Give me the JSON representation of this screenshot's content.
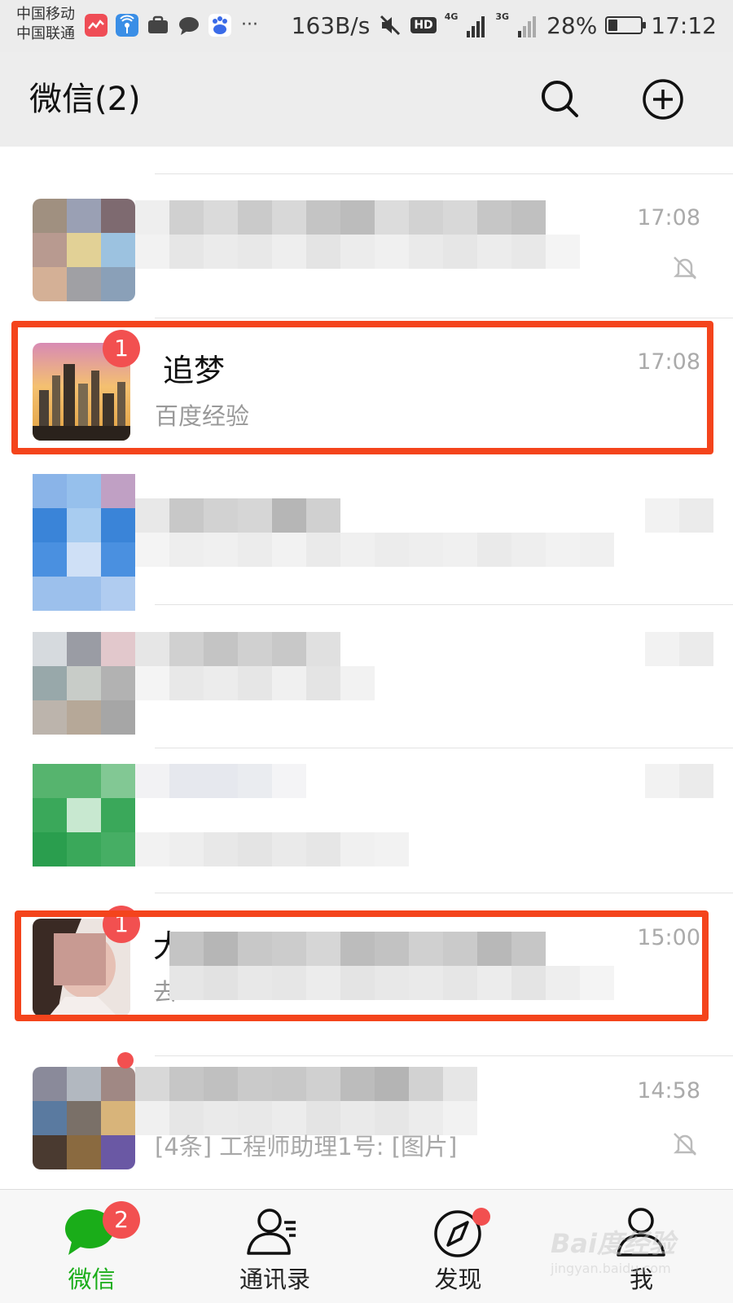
{
  "status_bar": {
    "carrier_1": "中国移动",
    "carrier_2": "中国联通",
    "more": "···",
    "net_speed": "163B/s",
    "hd": "HD",
    "net_4g": "4G",
    "net_3g": "3G",
    "battery": "28%",
    "battery_level": 0.28,
    "time": "17:12"
  },
  "header": {
    "title": "微信(2)",
    "search_icon": "search-icon",
    "add_icon": "plus-circle-icon"
  },
  "chats": [
    {
      "name": "",
      "preview": "",
      "time": "17:08",
      "muted": true,
      "pixelated": true
    },
    {
      "name": "追梦",
      "preview": "百度经验",
      "time": "17:08",
      "unread": "1",
      "highlighted": true
    },
    {
      "name": "",
      "preview": "",
      "time": "",
      "pixelated": true
    },
    {
      "name": "",
      "preview": "",
      "time": "",
      "pixelated": true
    },
    {
      "name": "",
      "preview": "",
      "time": "",
      "pixelated": true
    },
    {
      "name": "大",
      "preview": "去",
      "time": "15:00",
      "unread": "1",
      "highlighted": true,
      "pixelated": true
    },
    {
      "name": "",
      "preview": "[4条] 工程师助理1号: [图片]",
      "time": "14:58",
      "muted": true,
      "pixelated": true
    }
  ],
  "tabs": [
    {
      "label": "微信",
      "badge": "2",
      "icon": "chat-bubble-icon",
      "active": true
    },
    {
      "label": "通讯录",
      "icon": "contacts-icon"
    },
    {
      "label": "发现",
      "icon": "compass-icon",
      "dot": true
    },
    {
      "label": "我",
      "icon": "person-icon"
    }
  ],
  "colors": {
    "accent_green": "#1aad19",
    "badge_red": "#f25050",
    "highlight_red": "#f4441c"
  },
  "watermark": {
    "text": "Bai度经验",
    "url": "jingyan.baidu.com"
  }
}
